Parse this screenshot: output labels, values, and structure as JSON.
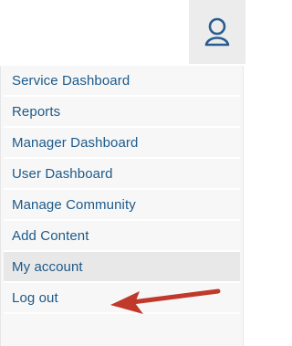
{
  "header": {
    "user_icon": "user-icon"
  },
  "menu": {
    "items": [
      {
        "label": "Service Dashboard"
      },
      {
        "label": "Reports"
      },
      {
        "label": "Manager Dashboard"
      },
      {
        "label": "User Dashboard"
      },
      {
        "label": "Manage Community"
      },
      {
        "label": "Add Content"
      },
      {
        "label": "My account"
      },
      {
        "label": "Log out"
      }
    ],
    "highlighted": "My account"
  },
  "annotation": {
    "arrow_icon": "arrow-icon",
    "arrow_color": "#c0392b"
  },
  "colors": {
    "link": "#1d5a8a",
    "menu_bg": "#f7f7f7",
    "active_bg": "#e8e8e8",
    "icon": "#2a5d8f"
  }
}
